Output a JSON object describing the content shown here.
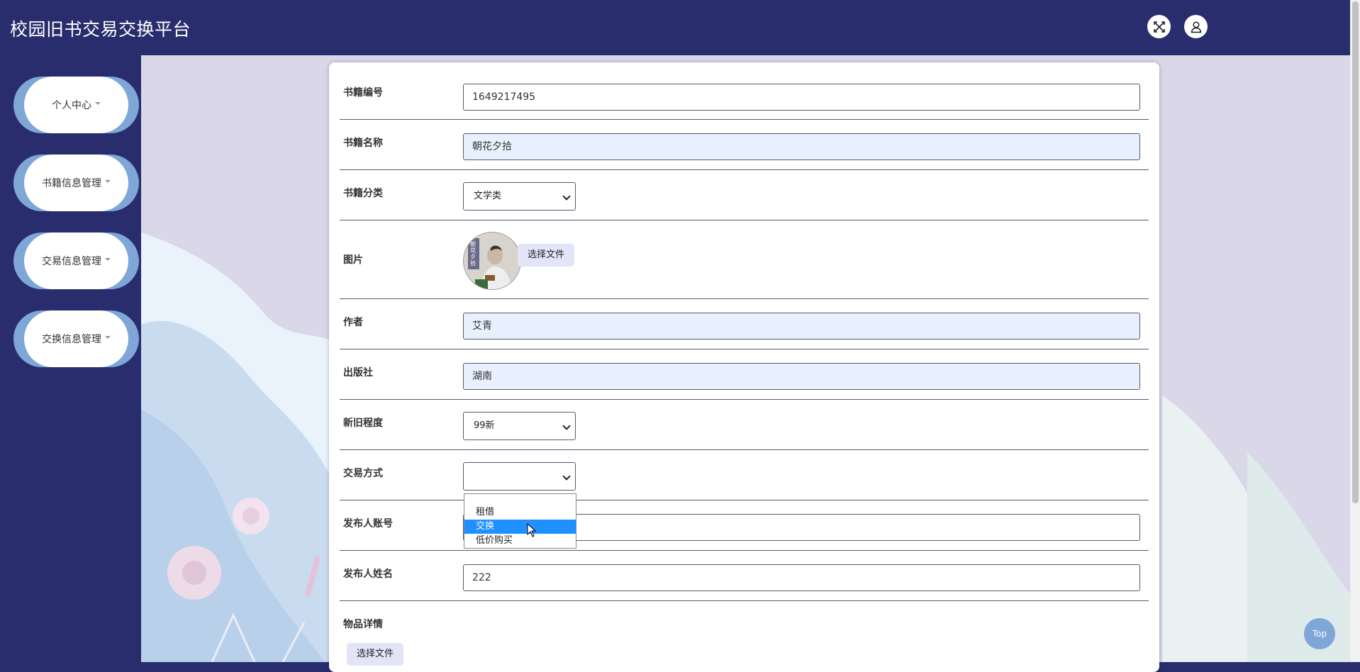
{
  "header": {
    "app_title": "校园旧书交易交换平台"
  },
  "sidebar": {
    "items": [
      {
        "label": "个人中心"
      },
      {
        "label": "书籍信息管理"
      },
      {
        "label": "交易信息管理"
      },
      {
        "label": "交换信息管理"
      }
    ]
  },
  "form": {
    "book_no": {
      "label": "书籍编号",
      "value": "1649217495"
    },
    "book_name": {
      "label": "书籍名称",
      "value": "朝花夕拾"
    },
    "category": {
      "label": "书籍分类",
      "value": "文学类"
    },
    "image": {
      "label": "图片",
      "file_button": "选择文件",
      "cover_text": "朝花夕拾"
    },
    "author": {
      "label": "作者",
      "value": "艾青"
    },
    "publisher": {
      "label": "出版社",
      "value": "湖南"
    },
    "condition": {
      "label": "新旧程度",
      "value": "99新"
    },
    "trade_mode": {
      "label": "交易方式",
      "value": "",
      "options": [
        "租借",
        "交换",
        "低价购买"
      ],
      "highlighted": "交换"
    },
    "publisher_account": {
      "label": "发布人账号",
      "value": ""
    },
    "publisher_name": {
      "label": "发布人姓名",
      "value": "222"
    },
    "details": {
      "label": "物品详情",
      "file_button": "选择文件"
    }
  },
  "top_button": {
    "label": "Top"
  },
  "colors": {
    "navy": "#2a2d6d",
    "accent_blue": "#7ea6d6",
    "highlight": "#1e90ff",
    "autofill": "#e8f0fe"
  }
}
